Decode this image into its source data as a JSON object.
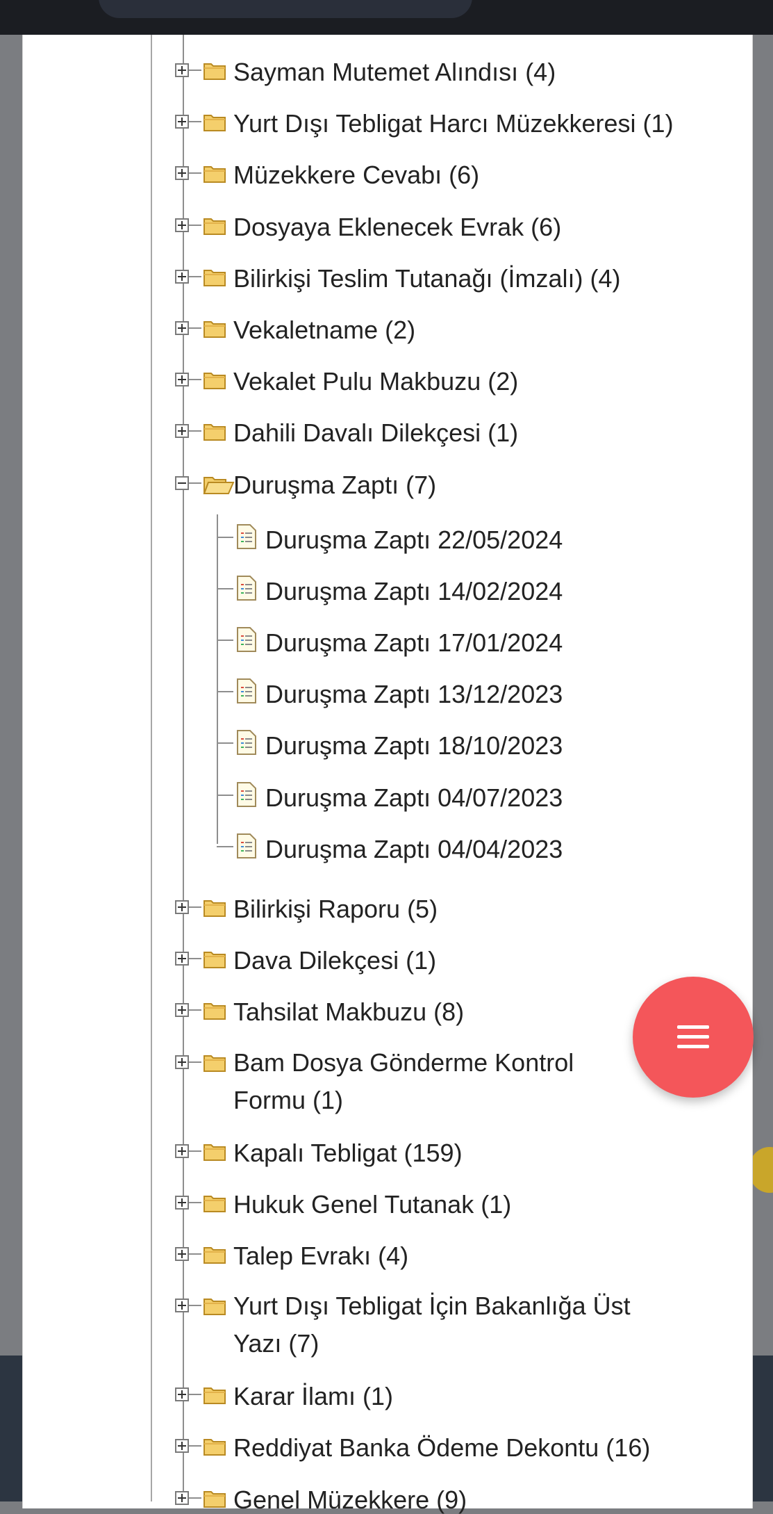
{
  "tree": {
    "folders_before": [
      {
        "label": "Sayman Mutemet Alındısı (4)"
      },
      {
        "label": "Yurt Dışı Tebligat Harcı Müzekkeresi (1)"
      },
      {
        "label": "Müzekkere Cevabı (6)"
      },
      {
        "label": "Dosyaya Eklenecek Evrak (6)"
      },
      {
        "label": "Bilirkişi Teslim Tutanağı (İmzalı) (4)"
      },
      {
        "label": "Vekaletname (2)"
      },
      {
        "label": "Vekalet Pulu Makbuzu (2)"
      },
      {
        "label": "Dahili Davalı Dilekçesi (1)"
      }
    ],
    "expanded_folder": {
      "label": "Duruşma Zaptı (7)",
      "documents": [
        {
          "label": "Duruşma Zaptı 22/05/2024"
        },
        {
          "label": "Duruşma Zaptı 14/02/2024"
        },
        {
          "label": "Duruşma Zaptı 17/01/2024"
        },
        {
          "label": "Duruşma Zaptı 13/12/2023"
        },
        {
          "label": "Duruşma Zaptı 18/10/2023"
        },
        {
          "label": "Duruşma Zaptı 04/07/2023"
        },
        {
          "label": "Duruşma Zaptı 04/04/2023"
        }
      ]
    },
    "folders_after": [
      {
        "label": "Bilirkişi Raporu (5)"
      },
      {
        "label": "Dava Dilekçesi (1)"
      },
      {
        "label": "Tahsilat Makbuzu (8)"
      },
      {
        "label": "Bam Dosya Gönderme Kontrol Formu (1)"
      },
      {
        "label": "Kapalı Tebligat (159)"
      },
      {
        "label": "Hukuk Genel Tutanak (1)"
      },
      {
        "label": "Talep Evrakı (4)"
      },
      {
        "label": "Yurt Dışı Tebligat İçin Bakanlığa Üst Yazı (7)"
      },
      {
        "label": "Karar İlamı (1)"
      },
      {
        "label": "Reddiyat Banka Ödeme Dekontu (16)"
      },
      {
        "label": "Genel Müzekkere (9)"
      }
    ]
  },
  "fab": {
    "icon": "menu-icon"
  },
  "colors": {
    "fab": "#f4565a",
    "folder": "#f4cf6c",
    "topbar": "#1b1d22"
  }
}
